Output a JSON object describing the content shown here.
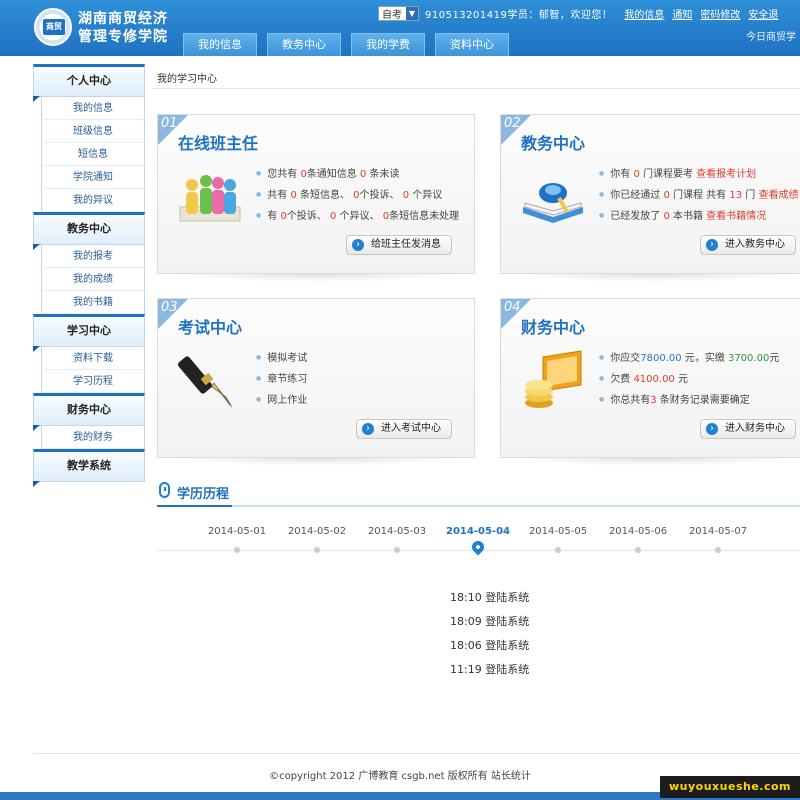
{
  "header": {
    "school_name_line1": "湖南商贸经济",
    "school_name_line2": "管理专修学院",
    "logo_text": "商贸",
    "exam_type": "自考",
    "welcome": "910513201419学员：郁智，欢迎您！",
    "links": [
      "我的信息",
      "通知",
      "密码修改",
      "安全退"
    ],
    "slogan": "今日商贸学",
    "tabs": [
      "我的信息",
      "教务中心",
      "我的学费",
      "资料中心"
    ]
  },
  "sidebar": {
    "sections": [
      {
        "title": "个人中心",
        "items": [
          "我的信息",
          "班级信息",
          "短信息",
          "学院通知",
          "我的异议"
        ]
      },
      {
        "title": "教务中心",
        "items": [
          "我的报考",
          "我的成绩",
          "我的书籍"
        ]
      },
      {
        "title": "学习中心",
        "items": [
          "资料下载",
          "学习历程"
        ]
      },
      {
        "title": "财务中心",
        "items": [
          "我的财务"
        ]
      },
      {
        "title": "教学系统",
        "items": []
      }
    ]
  },
  "breadcrumb": "我的学习中心",
  "cards": {
    "teacher": {
      "num": "01",
      "title": "在线班主任",
      "l1a": "您共有 ",
      "l1b": "0",
      "l1c": "条通知信息 ",
      "l1d": "0",
      "l1e": " 条未读",
      "l2a": "共有 ",
      "l2b": "0",
      "l2c": " 条短信息、 ",
      "l2d": "0",
      "l2e": "个投诉、 ",
      "l2f": "0",
      "l2g": " 个异议",
      "l3a": "有 ",
      "l3b": "0",
      "l3c": "个投诉、 ",
      "l3d": "0",
      "l3e": " 个异议、 ",
      "l3f": "0",
      "l3g": "条短信息未处理",
      "button": "给班主任发消息"
    },
    "academic": {
      "num": "02",
      "title": "教务中心",
      "l1a": "你有 ",
      "l1b": "0",
      "l1c": " 门课程要考 ",
      "l1d": "查看报考计划",
      "l2a": "你已经通过 ",
      "l2b": "0",
      "l2c": " 门课程 共有 ",
      "l2d": "13",
      "l2e": " 门 ",
      "l2f": "查看成绩",
      "l3a": "已经发放了 ",
      "l3b": "0",
      "l3c": " 本书籍 ",
      "l3d": "查看书籍情况",
      "button": "进入教务中心"
    },
    "exam": {
      "num": "03",
      "title": "考试中心",
      "items": [
        "模拟考试",
        "章节练习",
        "网上作业"
      ],
      "button": "进入考试中心"
    },
    "finance": {
      "num": "04",
      "title": "财务中心",
      "l1a": "你应交",
      "l1b": "7800.00",
      "l1c": " 元，实缴 ",
      "l1d": "3700.00",
      "l1e": "元",
      "l2a": "欠费 ",
      "l2b": "4100.00",
      "l2c": " 元",
      "l3a": "你总共有",
      "l3b": "3",
      "l3c": " 条财务记录需要确定",
      "button": "进入财务中心"
    }
  },
  "timeline": {
    "title": "学历历程",
    "dates": [
      "2014-05-01",
      "2014-05-02",
      "2014-05-03",
      "2014-05-04",
      "2014-05-05",
      "2014-05-06",
      "2014-05-07"
    ],
    "active_index": 3,
    "events": [
      "18:10 登陆系统",
      "18:09 登陆系统",
      "18:06 登陆系统",
      "11:19 登陆系统"
    ]
  },
  "footer": {
    "copyright": "©copyright 2012 广博教育 csgb.net 版权所有 站长统计",
    "watermark": "wuyouxueshe.com"
  },
  "colors": {
    "brand": "#1f72c2",
    "highlight": "#e03b2e",
    "paid": "#2a9a3a"
  }
}
